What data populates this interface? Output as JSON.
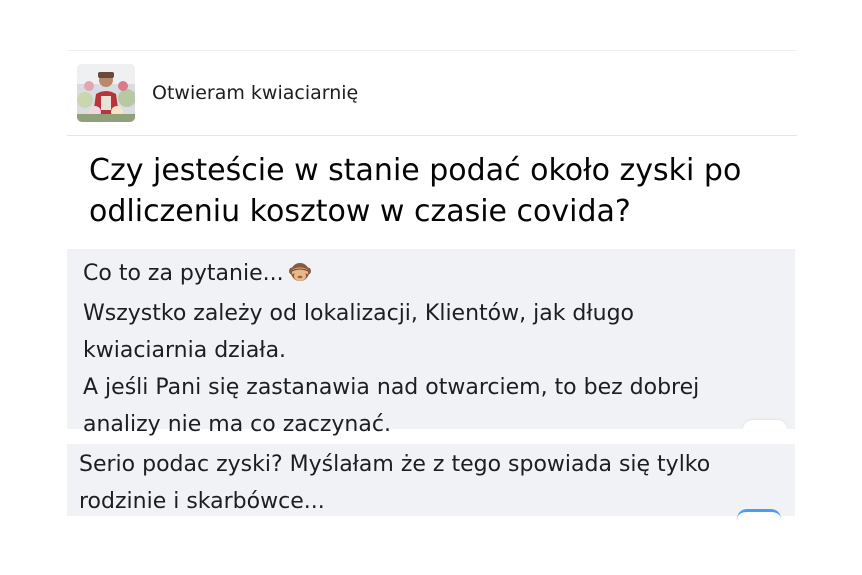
{
  "group": {
    "name": "Otwieram kwiaciarnię",
    "avatar_icon": "florist-avatar-photo"
  },
  "post": {
    "question_lines": [
      "Czy jesteście w stanie podać około zyski po",
      "odliczeniu kosztow w czasie covida?"
    ]
  },
  "comments": [
    {
      "lines": [
        "Co to za pytanie...",
        "Wszystko zależy od lokalizacji, Klientów, jak długo",
        "kwiaciarnia działa.",
        "A jeśli Pani się zastanawia nad otwarciem, to bez dobrej",
        "analizy nie ma co zaczynać."
      ],
      "emoji": "see-no-evil-monkey-emoji"
    },
    {
      "lines": [
        "Serio podac zyski? Myślałam że z tego spowiada się tylko",
        "rodzinie i skarbówce..."
      ]
    }
  ],
  "colors": {
    "comment_bg": "#f0f2f5",
    "divider": "#e4e6eb",
    "reaction_blue": "#4c9cf1"
  }
}
